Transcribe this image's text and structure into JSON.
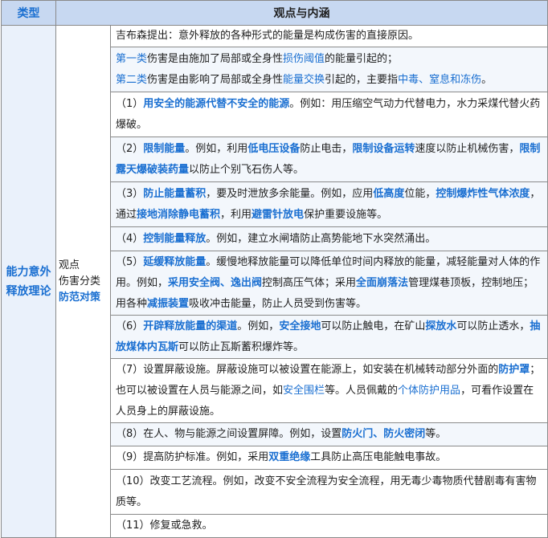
{
  "header": {
    "col_type": "类型",
    "col_view": "观点与内涵"
  },
  "type_label": "能力意外释放理论",
  "sub_label": {
    "line1": "观点",
    "line2": "伤害分类",
    "line3": "防范对策"
  },
  "rows": [
    {
      "segs": [
        {
          "t": "吉布森提出：意外释放的各种形式的能量是构成伤害的直接原因。"
        }
      ]
    },
    {
      "segs": [
        {
          "t": "第一类",
          "s": "n"
        },
        {
          "t": "伤害是由施加了局部或全身性"
        },
        {
          "t": "损伤阈值",
          "s": "n"
        },
        {
          "t": "的能量引起的；"
        },
        {
          "br": true
        },
        {
          "t": "第二类",
          "s": "n"
        },
        {
          "t": "伤害是由影响了局部或全身性"
        },
        {
          "t": "能量交换",
          "s": "n"
        },
        {
          "t": "引起的，主要指"
        },
        {
          "t": "中毒、窒息和冻伤",
          "s": "n"
        },
        {
          "t": "。"
        }
      ]
    },
    {
      "segs": [
        {
          "t": "（1）"
        },
        {
          "t": "用安全的能源代替不安全的能源",
          "s": "b"
        },
        {
          "t": "。例如：用压缩空气动力代替电力，水力采煤代替火药爆破。"
        }
      ]
    },
    {
      "segs": [
        {
          "t": "（2）"
        },
        {
          "t": "限制能量",
          "s": "b"
        },
        {
          "t": "。例如，利用"
        },
        {
          "t": "低电压设备",
          "s": "b"
        },
        {
          "t": "防止电击，"
        },
        {
          "t": "限制设备运转",
          "s": "b"
        },
        {
          "t": "速度以防止机械伤害，"
        },
        {
          "t": "限制露天爆破装药量",
          "s": "b"
        },
        {
          "t": "以防止个别飞石伤人等。"
        }
      ]
    },
    {
      "segs": [
        {
          "t": "（3）"
        },
        {
          "t": "防止能量蓄积",
          "s": "b"
        },
        {
          "t": "，要及时泄放多余能量。例如，应用"
        },
        {
          "t": "低高度",
          "s": "b"
        },
        {
          "t": "位能，"
        },
        {
          "t": "控制爆炸性气体浓度",
          "s": "b"
        },
        {
          "t": "，通过"
        },
        {
          "t": "接地消除静电蓄积",
          "s": "b"
        },
        {
          "t": "，利用"
        },
        {
          "t": "避雷针放电",
          "s": "b"
        },
        {
          "t": "保护重要设施等。"
        }
      ]
    },
    {
      "segs": [
        {
          "t": "（4）"
        },
        {
          "t": "控制能量释放",
          "s": "b"
        },
        {
          "t": "。例如，建立水闸墙防止高势能地下水突然涌出。"
        }
      ]
    },
    {
      "segs": [
        {
          "t": "（5）"
        },
        {
          "t": "延缓释放能量",
          "s": "b"
        },
        {
          "t": "。缓慢地释放能量可以降低单位时间内释放的能量，减轻能量对人体的作用。例如，"
        },
        {
          "t": "采用安全阀、逸出阀",
          "s": "b"
        },
        {
          "t": "控制高压气体；采用"
        },
        {
          "t": "全面崩落法",
          "s": "b"
        },
        {
          "t": "管理煤巷顶板，控制地压；用各种"
        },
        {
          "t": "减振装置",
          "s": "b"
        },
        {
          "t": "吸收冲击能量，防止人员受到伤害等。"
        }
      ]
    },
    {
      "segs": [
        {
          "t": "（6）"
        },
        {
          "t": "开辟释放能量的渠道",
          "s": "b"
        },
        {
          "t": "。例如，"
        },
        {
          "t": "安全接地",
          "s": "b"
        },
        {
          "t": "可以防止触电，在矿山"
        },
        {
          "t": "探放水",
          "s": "b"
        },
        {
          "t": "可以防止透水，"
        },
        {
          "t": "抽放煤体内瓦斯",
          "s": "b"
        },
        {
          "t": "可以防止瓦斯蓄积爆炸等。"
        }
      ]
    },
    {
      "segs": [
        {
          "t": "（7）设置屏蔽设施。屏蔽设施可以被设置在能源上，如安装在机械转动部分外面的"
        },
        {
          "t": "防护罩",
          "s": "b"
        },
        {
          "t": "；也可以被设置在人员与能源之间，如"
        },
        {
          "t": "安全围栏",
          "s": "n"
        },
        {
          "t": "等。人员佩戴的"
        },
        {
          "t": "个体防护用品",
          "s": "n"
        },
        {
          "t": "，可看作设置在人员身上的屏蔽设施。"
        }
      ]
    },
    {
      "segs": [
        {
          "t": "（8）在人、物与能源之间设置屏障。例如，设置"
        },
        {
          "t": "防火门、防火密闭",
          "s": "b"
        },
        {
          "t": "等。"
        }
      ]
    },
    {
      "segs": [
        {
          "t": "（9）提高防护标准。例如，采用"
        },
        {
          "t": "双重绝缘",
          "s": "b"
        },
        {
          "t": "工具防止高压电能触电事故。"
        }
      ]
    },
    {
      "segs": [
        {
          "t": "（10）改变工艺流程。例如，改变不安全流程为安全流程，用无毒少毒物质代替剧毒有害物质等。"
        }
      ]
    },
    {
      "segs": [
        {
          "t": "（11）修复或急救。"
        }
      ]
    }
  ]
}
